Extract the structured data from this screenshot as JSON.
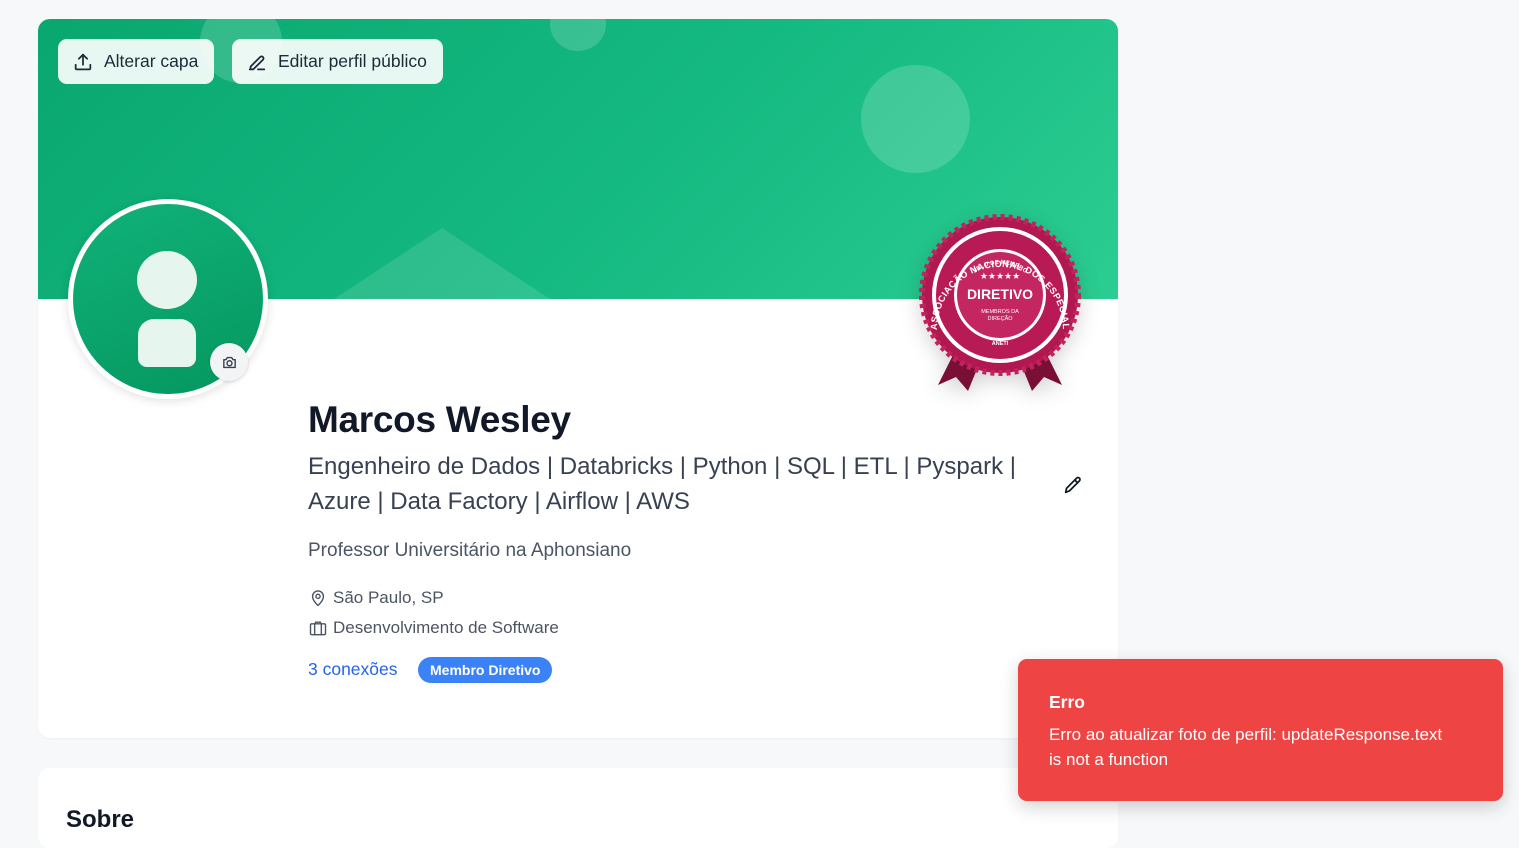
{
  "cover": {
    "change_cover_label": "Alterar capa",
    "edit_public_profile_label": "Editar perfil público",
    "upload_icon": "upload-icon",
    "pencil_icon": "pencil-icon"
  },
  "seal": {
    "outer_text": "ASSOCIAÇÃO NACIONAL DOS ESPECIALISTAS EM TI",
    "top_text": "SELO DE MEMBRO",
    "stars": "★★★★★",
    "main_text": "DIRETIVO",
    "sub_text_1": "MEMBROS DA",
    "sub_text_2": "DIREÇÃO",
    "brand": "ANETI"
  },
  "profile": {
    "name": "Marcos Wesley",
    "headline_line1": "Engenheiro de Dados | Databricks | Python | SQL | ETL | Pyspark |",
    "headline_line2": "Azure | Data Factory | Airflow | AWS",
    "job": "Professor Universitário na Aphonsiano",
    "location": "São Paulo, SP",
    "industry": "Desenvolvimento de Software",
    "connections": "3 conexões",
    "badge": "Membro Diretivo"
  },
  "second_card": {
    "title": "Sobre"
  },
  "toast": {
    "title": "Erro",
    "message_line1": "Erro ao atualizar foto de perfil: updateResponse.text",
    "message_line2": "is not a function"
  },
  "colors": {
    "cover_green": "#14b981",
    "seal_crimson": "#b0184f",
    "link_blue": "#2563eb",
    "badge_blue": "#3b82f6",
    "toast_red": "#ef4444"
  }
}
